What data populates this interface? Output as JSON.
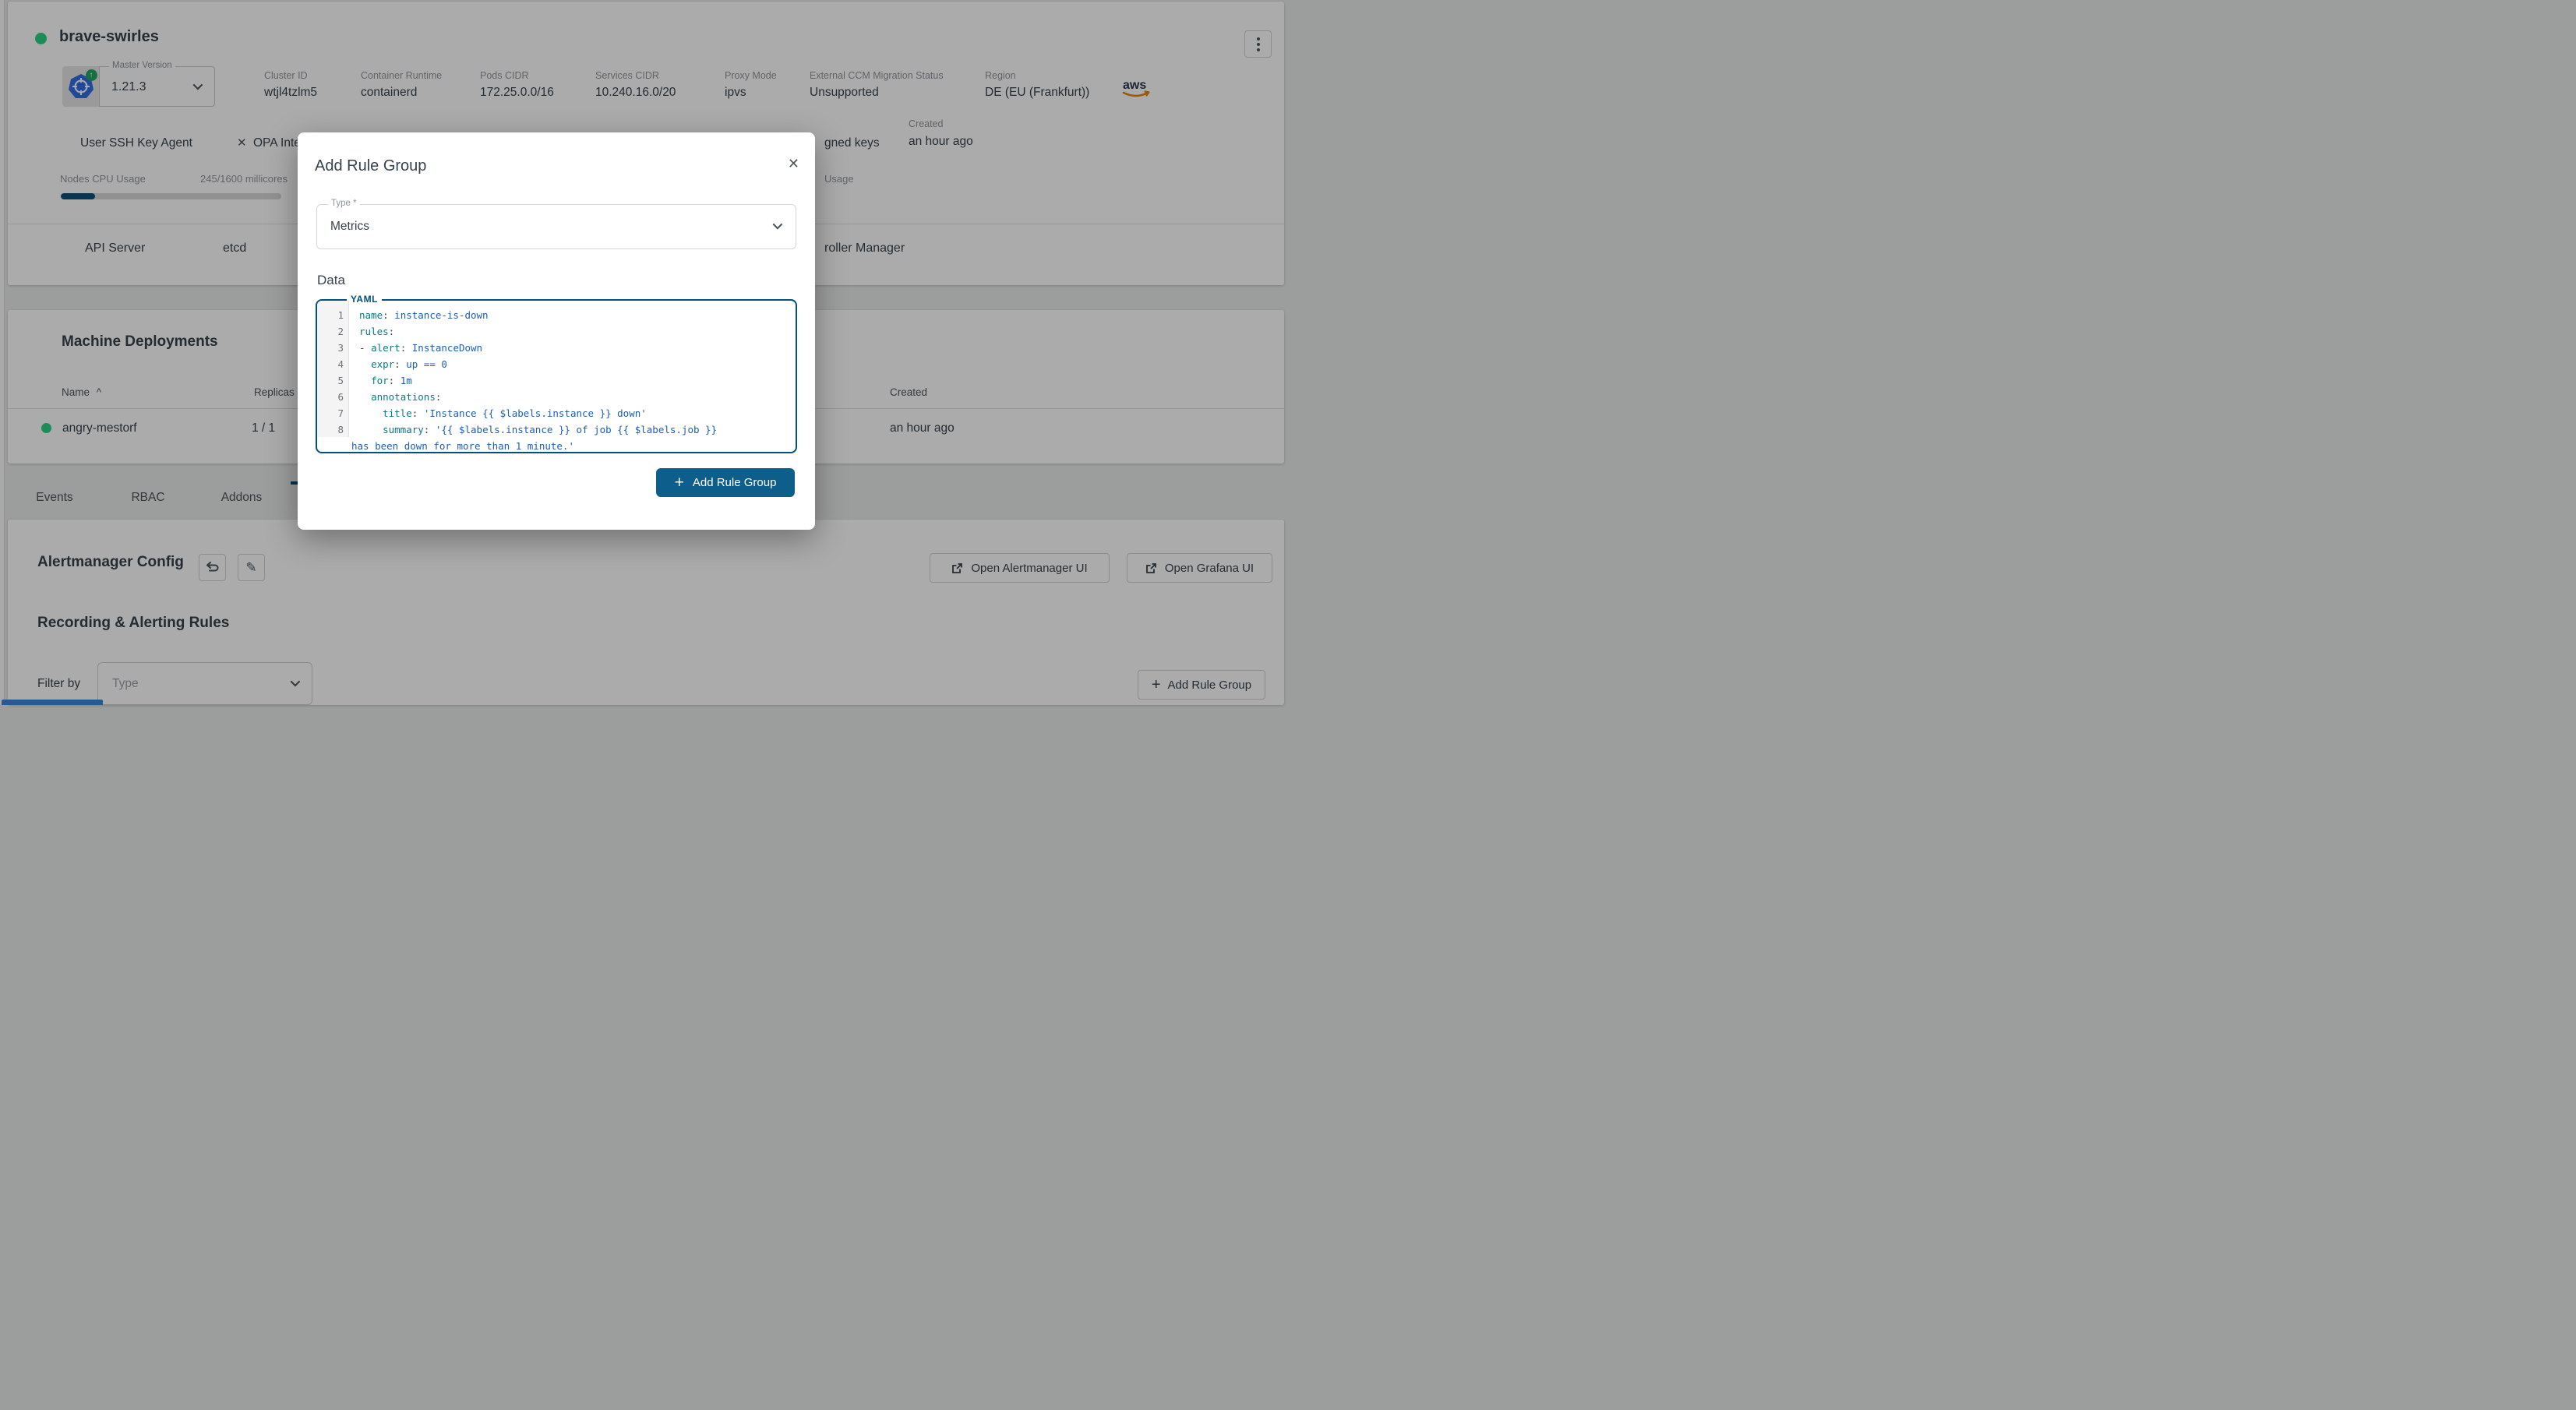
{
  "cluster": {
    "name": "brave-swirles",
    "master_version_label": "Master Version",
    "master_version": "1.21.3",
    "info": [
      {
        "label": "Cluster ID",
        "value": "wtjl4tzlm5"
      },
      {
        "label": "Container Runtime",
        "value": "containerd"
      },
      {
        "label": "Pods CIDR",
        "value": "172.25.0.0/16"
      },
      {
        "label": "Services CIDR",
        "value": "10.240.16.0/20"
      },
      {
        "label": "Proxy Mode",
        "value": "ipvs"
      },
      {
        "label": "External CCM Migration Status",
        "value": "Unsupported"
      },
      {
        "label": "Region",
        "value": "DE (EU (Frankfurt))"
      }
    ],
    "provider": "aws",
    "created_label": "Created",
    "created_value": "an hour ago",
    "ssh_key_agent_label": "User SSH Key Agent",
    "opa_label_partial": "OPA Inte",
    "assigned_keys_partial": "gned keys",
    "cpu_usage_label": "Nodes CPU Usage",
    "cpu_usage_value": "245/1600 millicores",
    "cpu_usage_percent": 15.4,
    "memory_usage_partial": "Usage",
    "health": {
      "api_server": "API Server",
      "etcd": "etcd",
      "controller_manager_partial": "roller Manager"
    }
  },
  "machine_deployments": {
    "title": "Machine Deployments",
    "columns": {
      "name": "Name",
      "sort_indicator": "^",
      "replicas": "Replicas",
      "created": "Created"
    },
    "rows": [
      {
        "name": "angry-mestorf",
        "replicas": "1 / 1",
        "created": "an hour ago",
        "status": "healthy-green"
      }
    ]
  },
  "tabs": [
    "Events",
    "RBAC",
    "Addons"
  ],
  "alerting": {
    "config_title": "Alertmanager Config",
    "open_alertmanager_label": "Open Alertmanager UI",
    "open_grafana_label": "Open Grafana UI",
    "rules_title": "Recording & Alerting Rules",
    "filter_label": "Filter by",
    "filter_placeholder": "Type",
    "add_rule_group_label": "Add Rule Group"
  },
  "modal": {
    "title": "Add Rule Group",
    "close_glyph": "✕",
    "type_label": "Type *",
    "type_value": "Metrics",
    "data_label": "Data",
    "editor_language": "YAML",
    "code_lines": [
      {
        "n": "1",
        "segments": [
          {
            "t": "name",
            "c": "key"
          },
          {
            "t": ": ",
            "c": "p"
          },
          {
            "t": "instance-is-down",
            "c": "val"
          }
        ]
      },
      {
        "n": "2",
        "segments": [
          {
            "t": "rules",
            "c": "key"
          },
          {
            "t": ":",
            "c": "p"
          }
        ]
      },
      {
        "n": "3",
        "segments": [
          {
            "t": "- ",
            "c": "p"
          },
          {
            "t": "alert",
            "c": "key"
          },
          {
            "t": ": ",
            "c": "p"
          },
          {
            "t": "InstanceDown",
            "c": "val"
          }
        ]
      },
      {
        "n": "4",
        "segments": [
          {
            "t": "  ",
            "c": "p"
          },
          {
            "t": "expr",
            "c": "key"
          },
          {
            "t": ": ",
            "c": "p"
          },
          {
            "t": "up == 0",
            "c": "val"
          }
        ]
      },
      {
        "n": "5",
        "segments": [
          {
            "t": "  ",
            "c": "p"
          },
          {
            "t": "for",
            "c": "key"
          },
          {
            "t": ": ",
            "c": "p"
          },
          {
            "t": "1m",
            "c": "val"
          }
        ]
      },
      {
        "n": "6",
        "segments": [
          {
            "t": "  ",
            "c": "p"
          },
          {
            "t": "annotations",
            "c": "key"
          },
          {
            "t": ":",
            "c": "p"
          }
        ]
      },
      {
        "n": "7",
        "segments": [
          {
            "t": "    ",
            "c": "p"
          },
          {
            "t": "title",
            "c": "key"
          },
          {
            "t": ": ",
            "c": "p"
          },
          {
            "t": "'Instance {{ $labels.instance }} down'",
            "c": "val"
          }
        ]
      },
      {
        "n": "8",
        "segments": [
          {
            "t": "    ",
            "c": "p"
          },
          {
            "t": "summary",
            "c": "key"
          },
          {
            "t": ": ",
            "c": "p"
          },
          {
            "t": "'{{ $labels.instance }} of job {{ $labels.job }}",
            "c": "val"
          }
        ]
      }
    ],
    "wrap_line": "has been down for more than 1 minute.'",
    "submit_label": "Add Rule Group",
    "plus_glyph": "+"
  },
  "colors": {
    "primary": "#00517d",
    "primary_button": "#0e5e8c",
    "healthy_green": "#2ed184",
    "code_key": "#087a82",
    "code_value": "#1b5eb4",
    "kubernetes_blue": "#326ce5",
    "aws_orange": "#e8820c",
    "progress_fill": "#10507a"
  }
}
